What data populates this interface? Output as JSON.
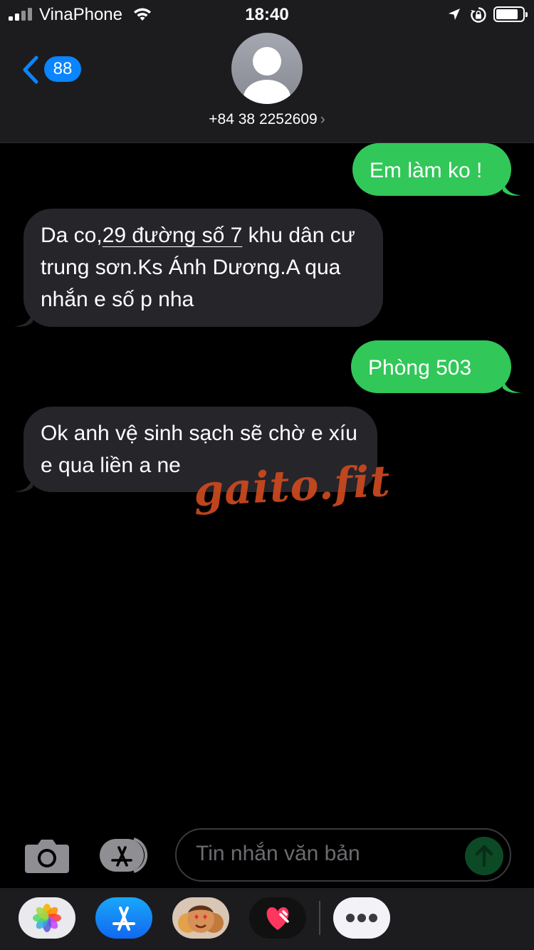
{
  "status_bar": {
    "carrier": "VinaPhone",
    "time": "18:40",
    "icons": [
      "signal-icon",
      "wifi-icon",
      "location-arrow-icon",
      "orientation-lock-icon",
      "battery-icon"
    ]
  },
  "header": {
    "back_badge": "88",
    "contact_name": "+84 38 2252609",
    "contact_chevron": "›"
  },
  "messages": [
    {
      "direction": "outgoing",
      "text": "Em làm ko !"
    },
    {
      "direction": "incoming",
      "text_before_link": "Da co,",
      "link": "29 đường số 7",
      "text_after_link": " khu dân cư trung sơn.Ks Ánh Dương.A qua nhắn e số p nha"
    },
    {
      "direction": "outgoing",
      "text": "Phòng 503"
    },
    {
      "direction": "incoming",
      "text": "Ok anh vệ sinh sạch sẽ chờ e xíu e qua liền a ne"
    }
  ],
  "watermark": "gaito.fit",
  "composer": {
    "placeholder": "Tin nhắn văn bản"
  },
  "app_drawer": [
    "photos-app-icon",
    "app-store-icon",
    "memoji-icon",
    "digital-touch-icon",
    "more-apps-icon"
  ],
  "colors": {
    "outgoing_bubble": "#32c759",
    "incoming_bubble": "#26252a",
    "accent": "#0a84ff",
    "watermark": "#c8481f"
  }
}
